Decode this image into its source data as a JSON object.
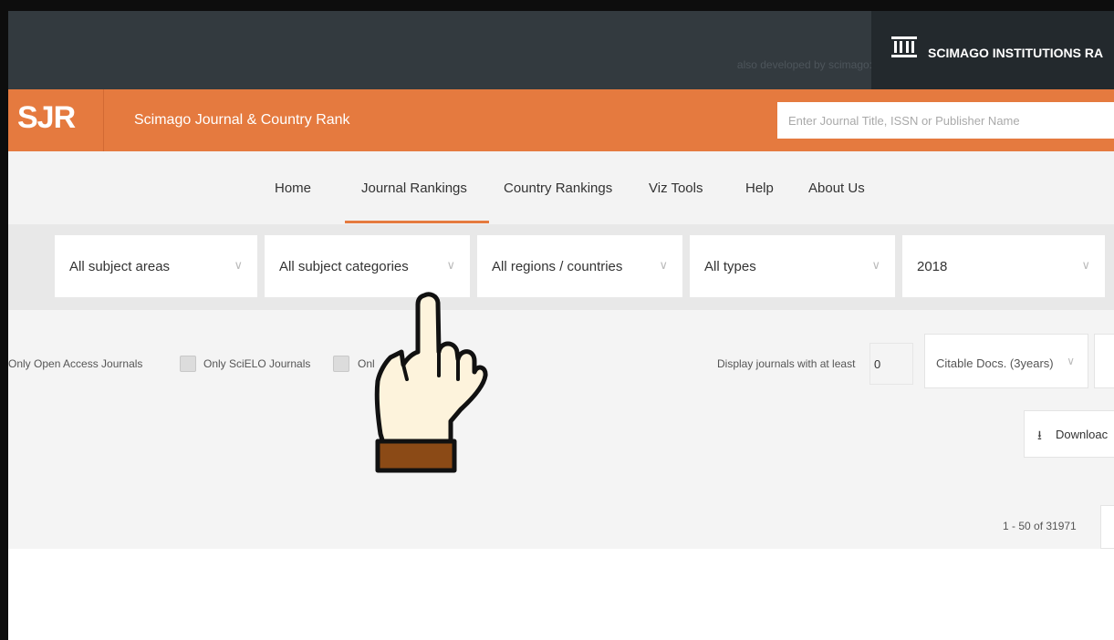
{
  "topbar": {
    "also_developed": "also developed by scimago:",
    "institutions_label": "SCIMAGO INSTITUTIONS RA"
  },
  "header": {
    "logo": "SJR",
    "site_title": "Scimago Journal & Country Rank",
    "search_placeholder": "Enter Journal Title, ISSN or Publisher Name"
  },
  "nav": {
    "items": [
      "Home",
      "Journal Rankings",
      "Country Rankings",
      "Viz Tools",
      "Help",
      "About Us"
    ],
    "active": "Journal Rankings"
  },
  "filters": {
    "subject_areas": "All subject areas",
    "subject_categories": "All subject categories",
    "regions": "All regions / countries",
    "types": "All types",
    "year": "2018"
  },
  "options": {
    "open_access": "Only Open Access Journals",
    "scielo": "Only SciELO Journals",
    "wos": "Onl",
    "display_label": "Display journals with at least",
    "min_value": "0",
    "metric": "Citable Docs. (3years)",
    "download": "Downloac",
    "pagination": "1 - 50 of 31971"
  },
  "colors": {
    "accent": "#e57a3f",
    "dark_bar": "#333a3f",
    "institutions_bg": "#23292d"
  }
}
